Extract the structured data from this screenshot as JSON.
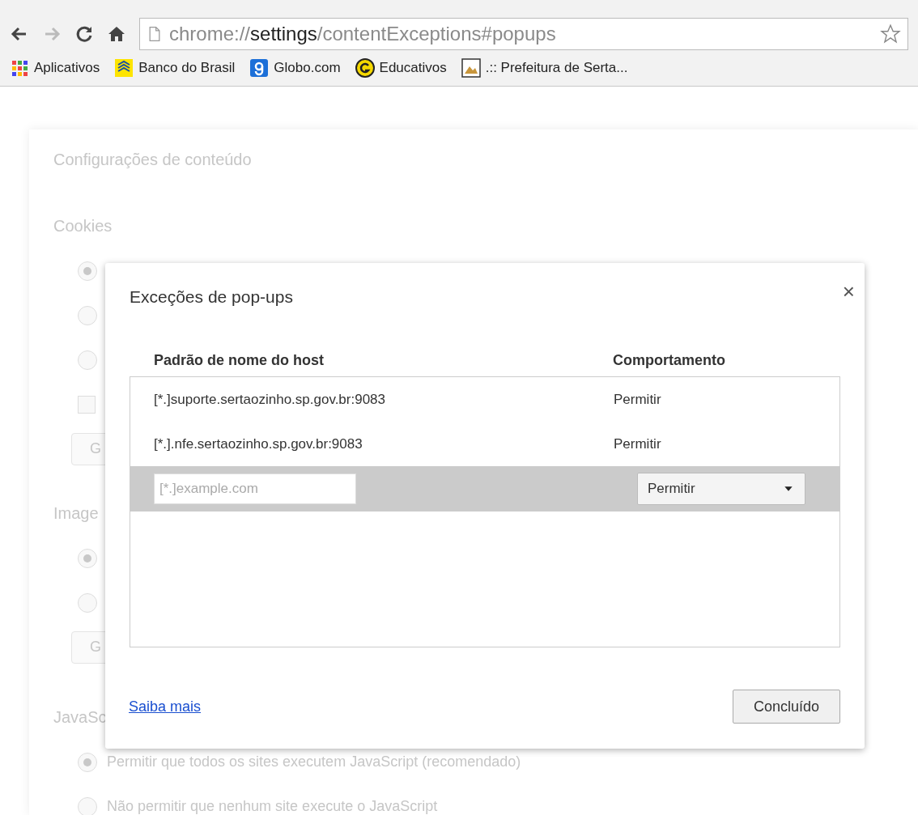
{
  "browser": {
    "url": {
      "scheme": "chrome://",
      "host": "settings",
      "path": "/contentExceptions#popups"
    },
    "forward_disabled": true,
    "bookmarks": [
      {
        "label": "Aplicativos",
        "kind": "apps"
      },
      {
        "label": "Banco do Brasil",
        "kind": "bank"
      },
      {
        "label": "Globo.com",
        "kind": "g"
      },
      {
        "label": "Educativos",
        "kind": "coin"
      },
      {
        "label": ".:: Prefeitura de Serta...",
        "kind": "picture"
      }
    ]
  },
  "background_page": {
    "title": "Configurações de conteúdo",
    "sections": [
      {
        "heading": "Cookies",
        "options": [
          {
            "kind": "radio",
            "selected": true
          },
          {
            "kind": "radio",
            "selected": false
          },
          {
            "kind": "radio",
            "selected": false
          },
          {
            "kind": "checkbox",
            "checked": false
          },
          {
            "kind": "button",
            "label": "G"
          }
        ]
      },
      {
        "heading": "Image",
        "options": [
          {
            "kind": "radio",
            "selected": true
          },
          {
            "kind": "radio",
            "selected": false
          },
          {
            "kind": "button",
            "label": "G"
          }
        ]
      },
      {
        "heading": "JavaSc",
        "options": [
          {
            "kind": "radio",
            "selected": true,
            "label": "Permitir que todos os sites executem JavaScript (recomendado)"
          },
          {
            "kind": "radio",
            "selected": false,
            "label": "Não permitir que nenhum site execute o JavaScript"
          }
        ]
      }
    ]
  },
  "dialog": {
    "title": "Exceções de pop-ups",
    "close": "×",
    "columns": [
      "Padrão de nome do host",
      "Comportamento"
    ],
    "rows": [
      {
        "pattern": "[*.]suporte.sertaozinho.sp.gov.br:9083",
        "behavior": "Permitir"
      },
      {
        "pattern": "[*.].nfe.sertaozinho.sp.gov.br:9083",
        "behavior": "Permitir"
      }
    ],
    "new_row": {
      "placeholder": "[*.]example.com",
      "behavior": "Permitir",
      "selected": true
    },
    "link": "Saiba mais",
    "done_button": "Concluído"
  }
}
